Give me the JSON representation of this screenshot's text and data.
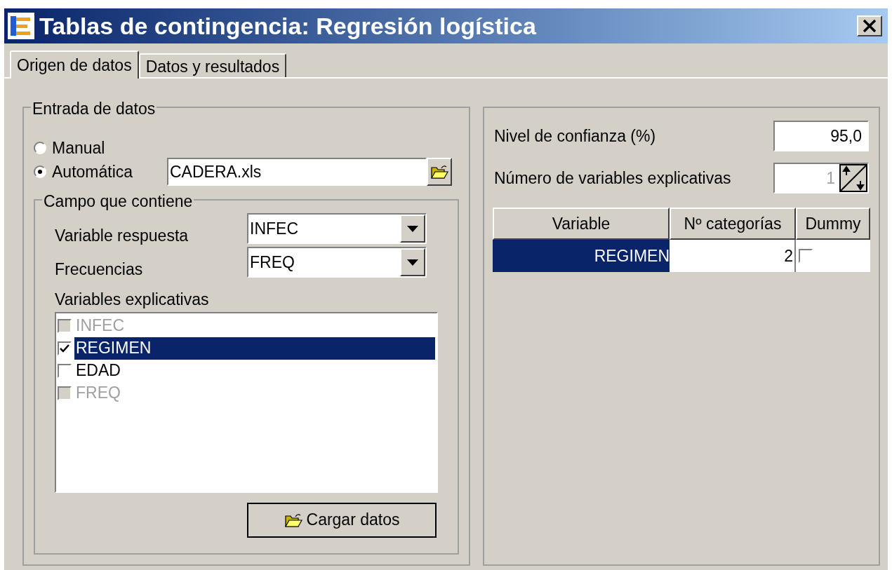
{
  "window": {
    "title": "Tablas de contingencia: Regresión logística"
  },
  "tabs": [
    {
      "label": "Origen de datos",
      "selected": true
    },
    {
      "label": "Datos y resultados",
      "selected": false
    }
  ],
  "entry": {
    "title": "Entrada de datos",
    "radios": [
      {
        "label": "Manual",
        "selected": false
      },
      {
        "label": "Automática",
        "selected": true
      }
    ],
    "file": "CADERA.xls"
  },
  "fields": {
    "title": "Campo que contiene",
    "dropdowns": [
      {
        "label": "Variable respuesta",
        "value": "INFEC"
      },
      {
        "label": "Frecuencias",
        "value": "FREQ"
      }
    ],
    "list_label": "Variables explicativas",
    "list": [
      {
        "label": "INFEC",
        "checked": false,
        "disabled": true,
        "selected": false
      },
      {
        "label": "REGIMEN",
        "checked": true,
        "disabled": false,
        "selected": true
      },
      {
        "label": "EDAD",
        "checked": false,
        "disabled": false,
        "selected": false
      },
      {
        "label": "FREQ",
        "checked": false,
        "disabled": true,
        "selected": false
      }
    ],
    "button": "Cargar datos"
  },
  "right": {
    "confidence_label": "Nivel de confianza (%)",
    "confidence": "95,0",
    "count_label": "Número de variables explicativas",
    "count": "1",
    "columns": [
      "Variable",
      "Nº categorías",
      "Dummy"
    ],
    "rows": [
      {
        "variable": "REGIMEN",
        "categories": "2",
        "dummy": false,
        "selected": true
      }
    ]
  }
}
